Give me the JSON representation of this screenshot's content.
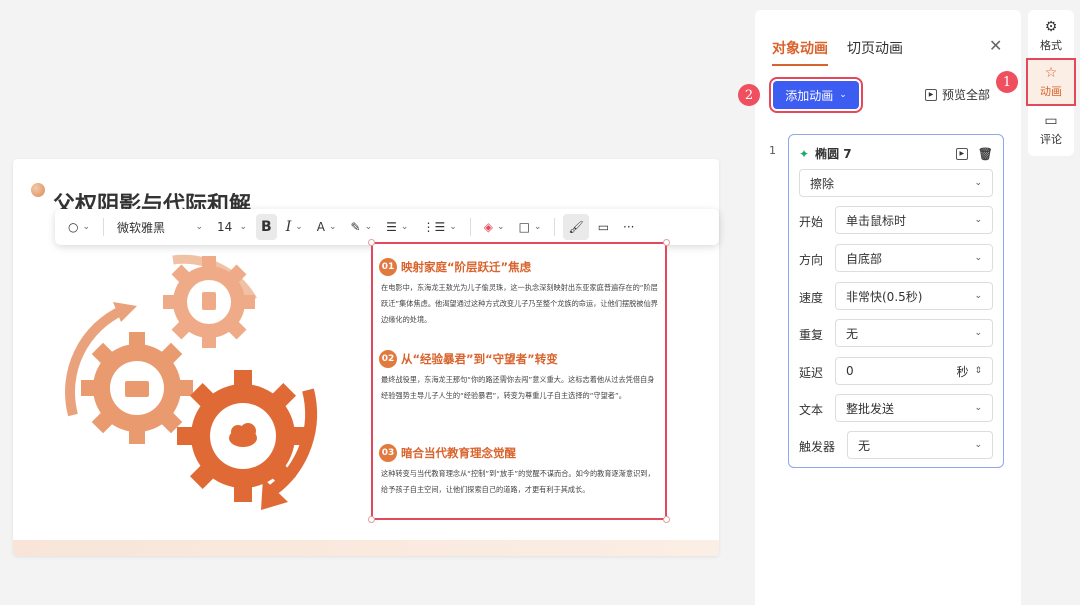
{
  "slide": {
    "title": "父权阴影与代际和解",
    "sections": [
      {
        "num": "01",
        "title": "映射家庭“阶层跃迁”焦虑",
        "body": "在电影中，东海龙王敖光为儿子偷灵珠，这一执念深刻映射出东亚家庭普遍存在的“阶层跃迁”集体焦虑。他渴望通过这种方式改变儿子乃至整个龙族的命运，让他们摆脱被仙界边缘化的处境。"
      },
      {
        "num": "02",
        "title": "从“经验暴君”到“守望者”转变",
        "body": "最终战役里，东海龙王那句“你的路还需你去闯”意义重大。这标志着他从过去凭借自身经验强势主导儿子人生的“经验暴君”，转变为尊重儿子自主选择的“守望者”。"
      },
      {
        "num": "03",
        "title": "暗合当代教育理念觉醒",
        "body": "这种转变与当代教育理念从“控制”到“放手”的觉醒不谋而合。如今的教育逐渐意识到，给予孩子自主空间，让他们探索自己的道路，才更有利于其成长。"
      }
    ]
  },
  "toolbar": {
    "font": "微软雅黑",
    "size": "14",
    "bold": "B",
    "italic": "I",
    "color": "A"
  },
  "panel": {
    "tab_object": "对象动画",
    "tab_page": "切页动画",
    "add_animation": "添加动画",
    "preview_all": "预览全部",
    "marker_1": "1",
    "marker_2": "2",
    "item_index": "1",
    "item_name": "椭圆 7",
    "effect": "擦除",
    "fields": {
      "start_label": "开始",
      "start_value": "单击鼠标时",
      "direction_label": "方向",
      "direction_value": "自底部",
      "speed_label": "速度",
      "speed_value": "非常快(0.5秒)",
      "repeat_label": "重复",
      "repeat_value": "无",
      "delay_label": "延迟",
      "delay_value": "0",
      "delay_unit": "秒",
      "text_label": "文本",
      "text_value": "整批发送",
      "trigger_label": "触发器",
      "trigger_value": "无"
    }
  },
  "rail": {
    "format": "格式",
    "animation": "动画",
    "comment": "评论"
  },
  "colors": {
    "accent": "#d9632c",
    "primary_button": "#3d5cf2",
    "highlight": "#e3495b",
    "gear_light": "#f0b08c",
    "gear_dark": "#e06a35"
  }
}
